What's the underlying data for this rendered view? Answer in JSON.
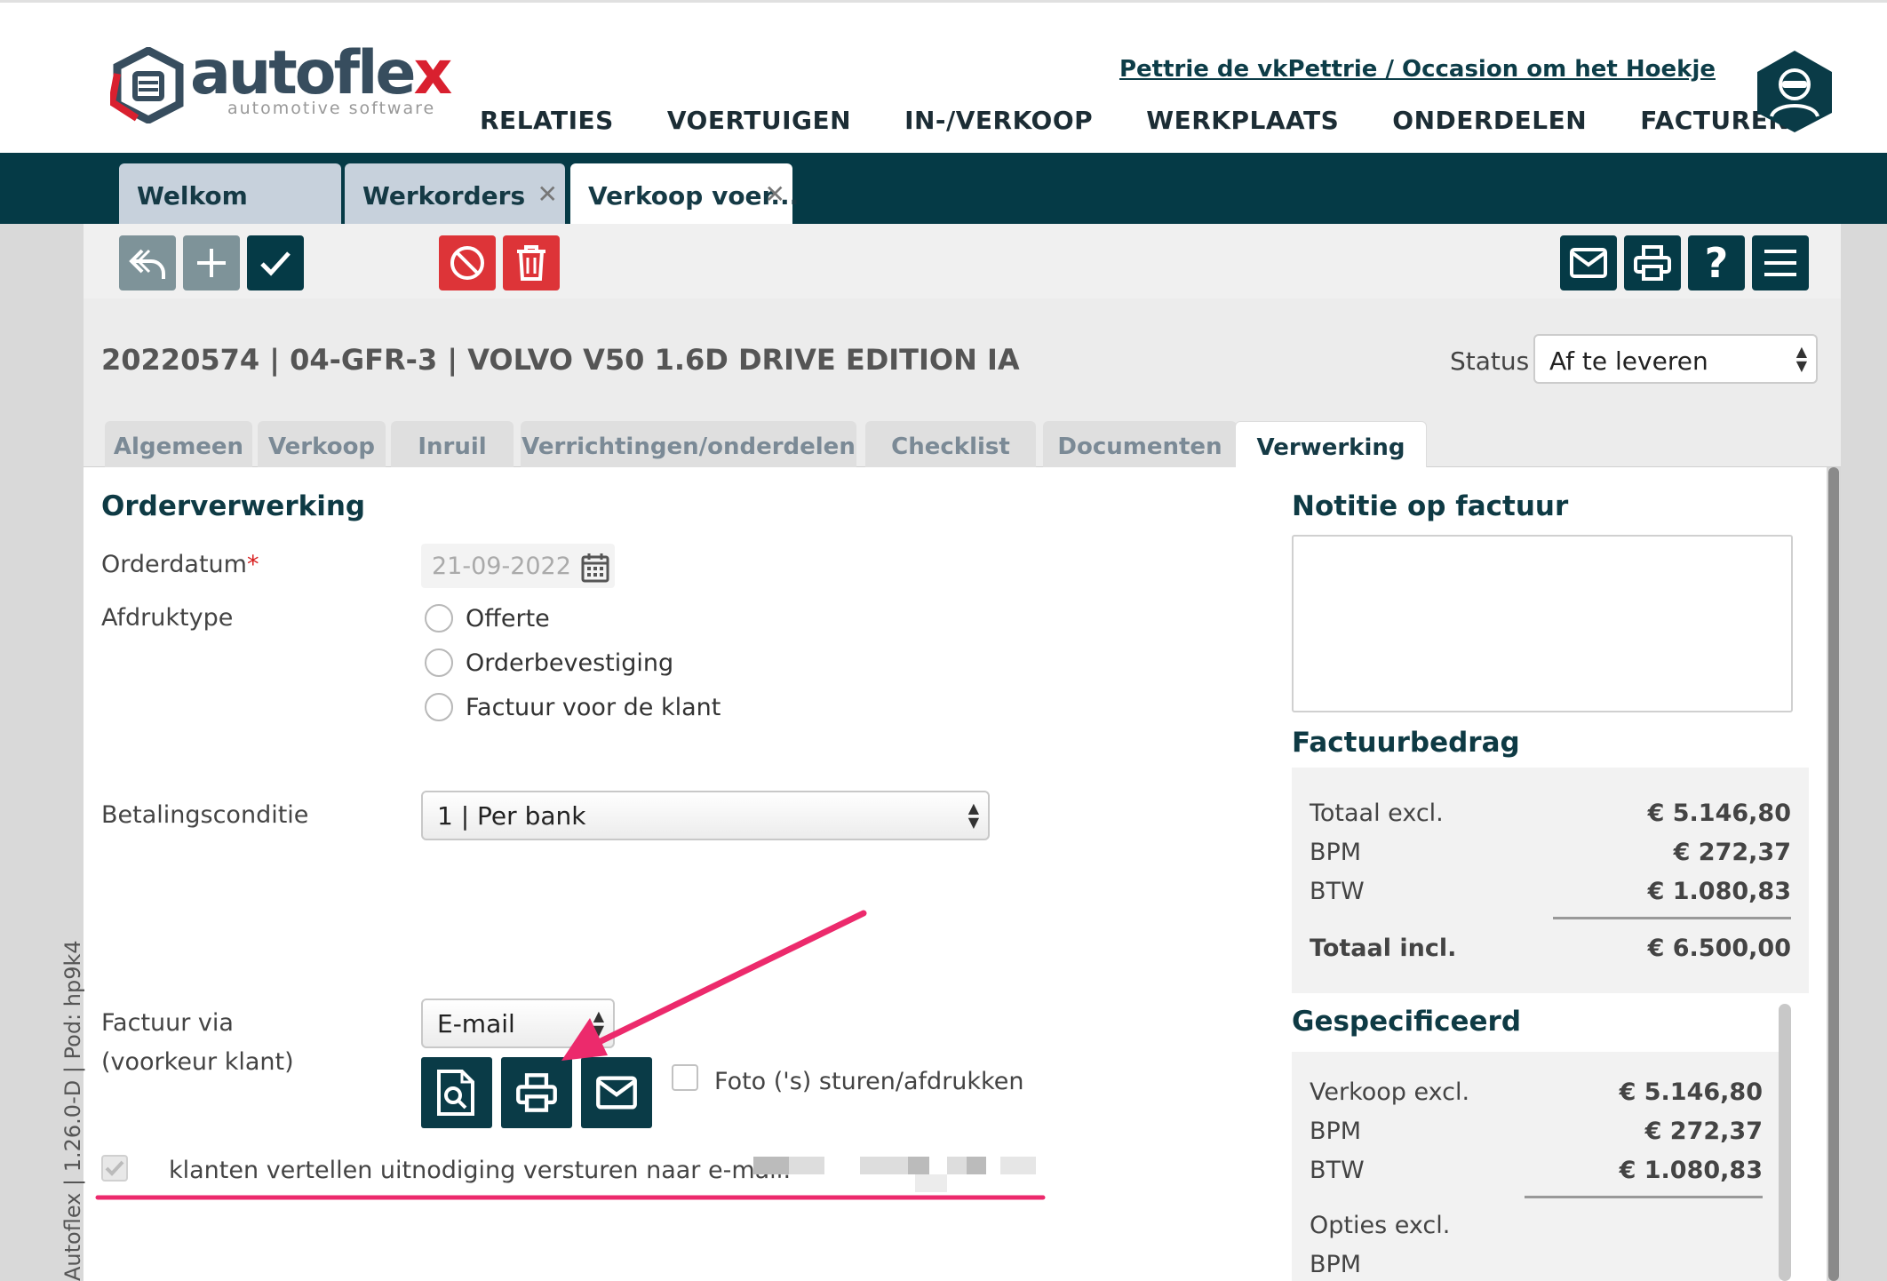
{
  "app": {
    "logo_text": "autoflex",
    "logo_subtitle": "automotive software",
    "user_link": "Pettrie de vkPettrie / Occasion om het Hoekje",
    "avatar_icon": "user-avatar-icon"
  },
  "main_nav": [
    "RELATIES",
    "VOERTUIGEN",
    "IN-/VERKOOP",
    "WERKPLAATS",
    "ONDERDELEN",
    "FACTUREN"
  ],
  "doc_tabs": [
    {
      "label": "Welkom",
      "closable": false
    },
    {
      "label": "Werkorders",
      "closable": true
    },
    {
      "label": "Verkoop voer...",
      "closable": true
    }
  ],
  "toolbar": {
    "left_icons": [
      "undo-icon",
      "add-icon",
      "check-icon"
    ],
    "danger_icons": [
      "cancel-icon",
      "trash-icon"
    ],
    "right_icons": [
      "mail-icon",
      "print-icon",
      "help-icon",
      "menu-icon"
    ]
  },
  "order": {
    "title": "20220574 | 04-GFR-3 | VOLVO V50 1.6D DRIVE EDITION IA",
    "status_label": "Status",
    "status_value": "Af te leveren"
  },
  "sub_tabs": [
    "Algemeen",
    "Verkoop",
    "Inruil",
    "Verrichtingen/onderdelen",
    "Checklist",
    "Documenten",
    "Verwerking"
  ],
  "active_sub_tab": "Verwerking",
  "processing": {
    "section_title": "Orderverwerking",
    "orderdate_label": "Orderdatum",
    "required_mark": "*",
    "orderdate_value": "21-09-2022",
    "print_type_label": "Afdruktype",
    "print_types": [
      "Offerte",
      "Orderbevestiging",
      "Factuur voor de klant"
    ],
    "payment_label": "Betalingsconditie",
    "payment_value": "1 | Per bank",
    "invoice_via_label": "Factuur via",
    "invoice_via_sub": "(voorkeur klant)",
    "invoice_via_value": "E-mail",
    "photo_label": "Foto ('s) sturen/afdrukken",
    "invite_label": "klanten vertellen uitnodiging versturen naar e-mail:"
  },
  "invoice_note": {
    "title": "Notitie op factuur",
    "text": ""
  },
  "invoice_amount": {
    "title": "Factuurbedrag",
    "rows": [
      {
        "label": "Totaal excl.",
        "value": "€ 5.146,80"
      },
      {
        "label": "BPM",
        "value": "€ 272,37"
      },
      {
        "label": "BTW",
        "value": "€ 1.080,83"
      }
    ],
    "total_label": "Totaal incl.",
    "total_value": "€ 6.500,00"
  },
  "specified": {
    "title": "Gespecificeerd",
    "rows": [
      {
        "label": "Verkoop excl.",
        "value": "€ 5.146,80"
      },
      {
        "label": "BPM",
        "value": "€ 272,37"
      },
      {
        "label": "BTW",
        "value": "€ 1.080,83"
      }
    ],
    "rows2": [
      {
        "label": "Opties excl."
      },
      {
        "label": "BPM"
      }
    ]
  },
  "version_text": "Autoflex | 1.26.0-D | Pod: hp9k4",
  "colors": {
    "brand_dark": "#053a46",
    "danger": "#dd3438",
    "toolbar_gray": "#7e9399",
    "annotation": "#ec2a6c"
  }
}
